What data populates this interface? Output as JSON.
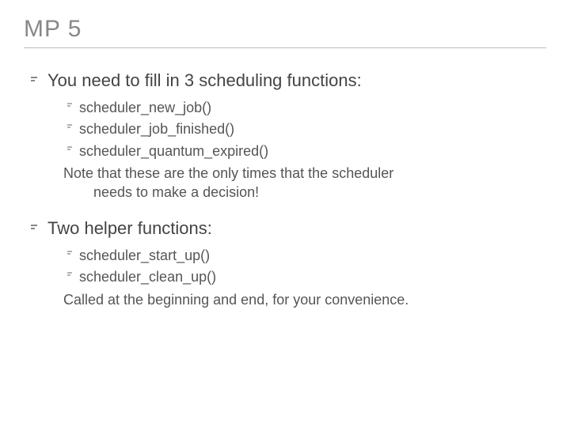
{
  "title": "MP 5",
  "sections": [
    {
      "heading": "You need to fill in 3 scheduling functions:",
      "items": [
        "scheduler_new_job()",
        "scheduler_job_finished()",
        "scheduler_quantum_expired()"
      ],
      "note": "Note that these are the only times that the scheduler",
      "note_cont": "needs to make a decision!"
    },
    {
      "heading": "Two helper functions:",
      "items": [
        "scheduler_start_up()",
        "scheduler_clean_up()"
      ],
      "note": "Called at the beginning and end, for your convenience.",
      "note_cont": ""
    }
  ]
}
